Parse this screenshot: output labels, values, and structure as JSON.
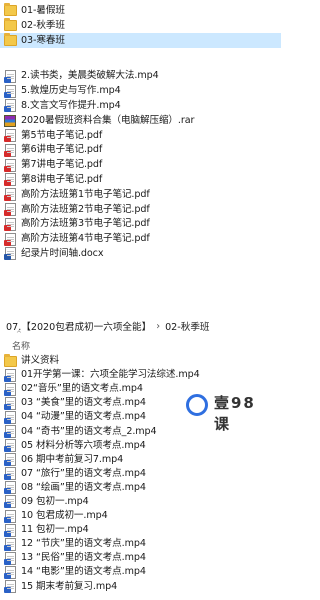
{
  "top_folders": [
    {
      "name": "01-暑假班",
      "selected": false
    },
    {
      "name": "02-秋季班",
      "selected": false
    },
    {
      "name": "03-寒春班",
      "selected": true
    }
  ],
  "files_top": [
    {
      "name": "2.读书类，美晨类破解大法.mp4",
      "type": "mp4"
    },
    {
      "name": "5.敦煌历史与写作.mp4",
      "type": "mp4"
    },
    {
      "name": "8.文言文写作提升.mp4",
      "type": "mp4"
    },
    {
      "name": "2020暑假班资料合集（电脑解压缩）.rar",
      "type": "rar"
    },
    {
      "name": "第5节电子笔记.pdf",
      "type": "pdf"
    },
    {
      "name": "第6讲电子笔记.pdf",
      "type": "pdf"
    },
    {
      "name": "第7讲电子笔记.pdf",
      "type": "pdf"
    },
    {
      "name": "第8讲电子笔记.pdf",
      "type": "pdf"
    },
    {
      "name": "高阶方法班第1节电子笔记.pdf",
      "type": "pdf"
    },
    {
      "name": "高阶方法班第2节电子笔记.pdf",
      "type": "pdf"
    },
    {
      "name": "高阶方法班第3节电子笔记.pdf",
      "type": "pdf"
    },
    {
      "name": "高阶方法班第4节电子笔记.pdf",
      "type": "pdf"
    },
    {
      "name": "纪录片时间轴.docx",
      "type": "docx"
    }
  ],
  "breadcrumb": [
    "07.【2020包君成初一六项全能】",
    "02-秋季班"
  ],
  "breadcrumb_sep": "›",
  "column_header": "名称",
  "files_bottom": [
    {
      "name": "讲义资料",
      "type": "folder"
    },
    {
      "name": "01开学第一课：六项全能学习法综述.mp4",
      "type": "mp4"
    },
    {
      "name": "02“音乐”里的语文考点.mp4",
      "type": "mp4"
    },
    {
      "name": "03 “美食”里的语文考点.mp4",
      "type": "mp4"
    },
    {
      "name": "04 “动漫”里的语文考点.mp4",
      "type": "mp4"
    },
    {
      "name": "04 “奇书”里的语文考点_2.mp4",
      "type": "mp4"
    },
    {
      "name": "05 材料分析等六项考点.mp4",
      "type": "mp4"
    },
    {
      "name": "06 期中考前复习7.mp4",
      "type": "mp4"
    },
    {
      "name": "07 “旅行”里的语文考点.mp4",
      "type": "mp4"
    },
    {
      "name": "08 “绘画”里的语文考点.mp4",
      "type": "mp4"
    },
    {
      "name": "09 包初一.mp4",
      "type": "mp4"
    },
    {
      "name": "10 包君成初一.mp4",
      "type": "mp4"
    },
    {
      "name": "11 包初一.mp4",
      "type": "mp4"
    },
    {
      "name": "12 “节庆”里的语文考点.mp4",
      "type": "mp4"
    },
    {
      "name": "13 “民俗”里的语文考点.mp4",
      "type": "mp4"
    },
    {
      "name": "14 “电影”里的语文考点.mp4",
      "type": "mp4"
    },
    {
      "name": "15 期末考前复习.mp4",
      "type": "mp4"
    }
  ],
  "watermark": {
    "text": "壹98课"
  }
}
